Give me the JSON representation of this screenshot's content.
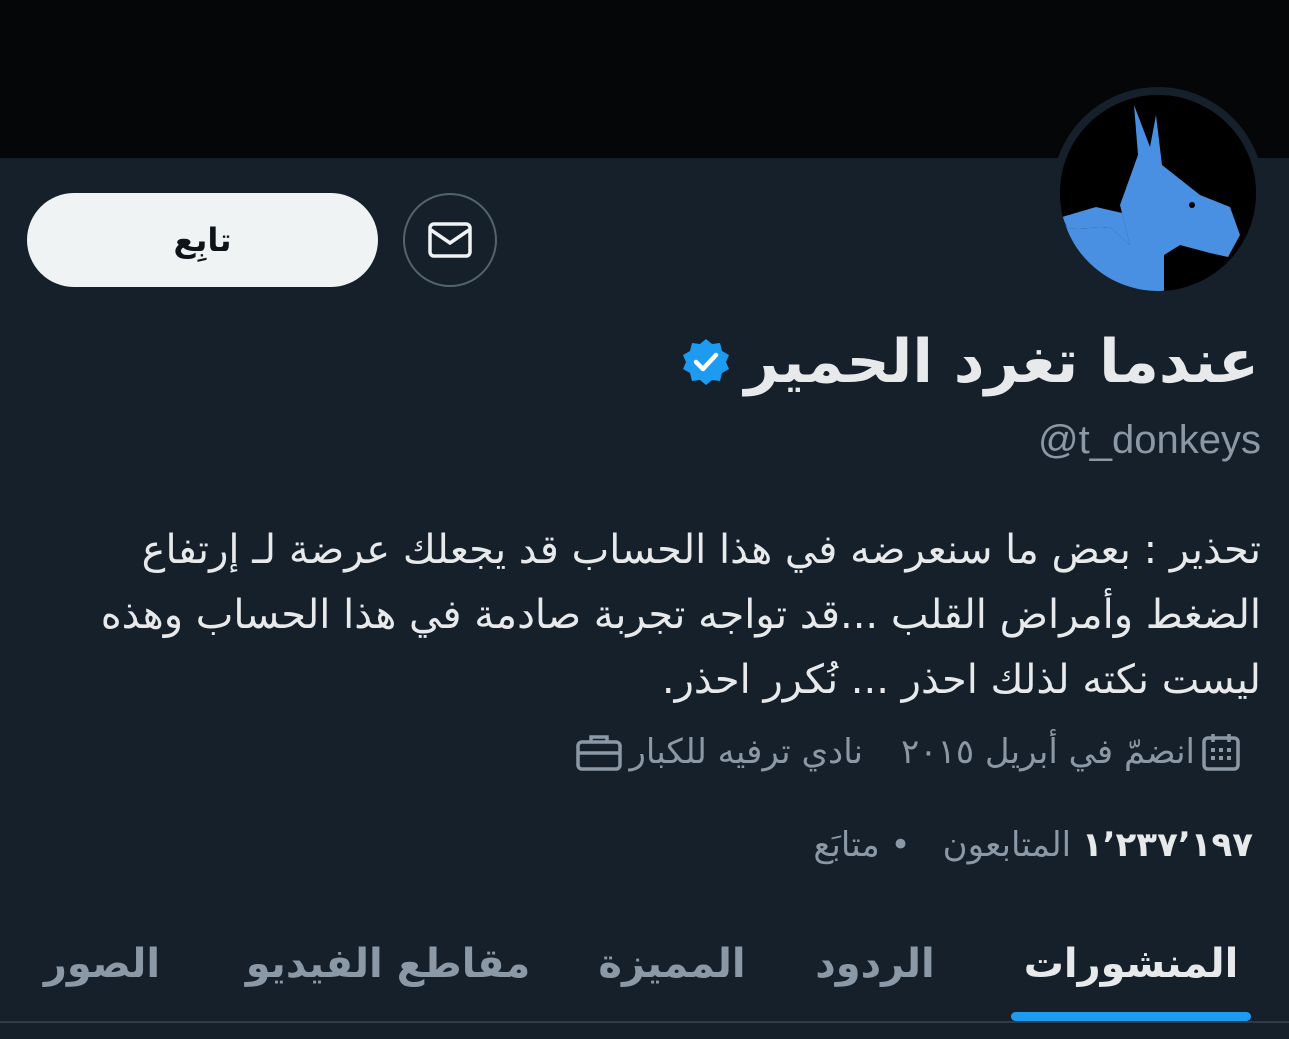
{
  "profile": {
    "display_name": "عندما تغرد الحمير",
    "handle": "@t_donkeys",
    "bio": "تحذير : بعض ما سنعرضه في هذا الحساب قد يجعلك عرضة لـ إرتفاع الضغط وأمراض القلب ...قد تواجه تجربة صادمة في هذا الحساب وهذه ليست نكته لذلك احذر ... نُكرر احذر.",
    "category": "نادي ترفيه للكبار",
    "joined": "انضمّ في أبريل ٢٠١٥",
    "following_label": "متابَع",
    "followers_count": "١٬٢٣٧٬١٩٧",
    "followers_label": "المتابعون",
    "verified": true
  },
  "actions": {
    "follow_label": "تابِع"
  },
  "tabs": [
    {
      "label": "المنشورات",
      "active": true
    },
    {
      "label": "الردود",
      "active": false
    },
    {
      "label": "المميزة",
      "active": false
    },
    {
      "label": "مقاطع الفيديو",
      "active": false
    },
    {
      "label": "الصور",
      "active": false
    }
  ],
  "icons": {
    "message": "envelope-icon",
    "verified": "verified-badge-icon",
    "category": "briefcase-icon",
    "joined": "calendar-icon"
  },
  "colors": {
    "background": "#15202b",
    "accent": "#1d9bf0",
    "muted": "#8b98a5",
    "avatar_donkey": "#4a90e2"
  }
}
